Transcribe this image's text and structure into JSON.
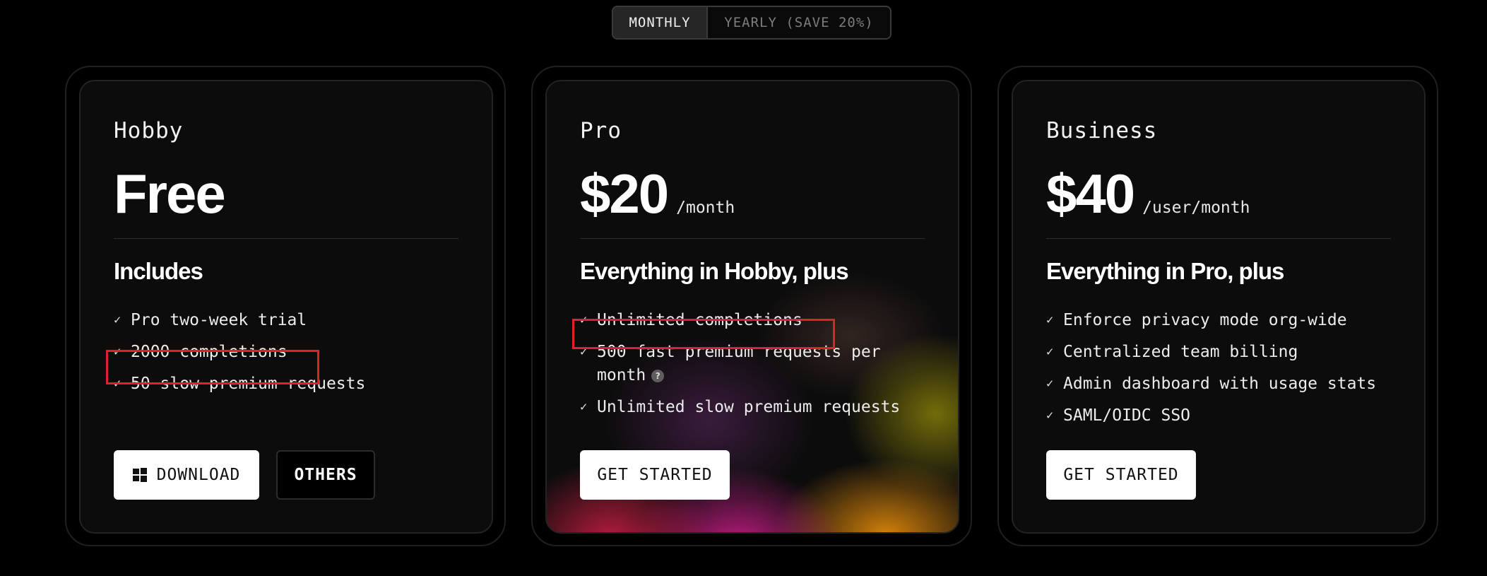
{
  "toggle": {
    "monthly": "MONTHLY",
    "yearly": "YEARLY (SAVE 20%)"
  },
  "plans": [
    {
      "name": "Hobby",
      "price": "Free",
      "period": "",
      "includes": "Includes",
      "features": [
        "Pro two-week trial",
        "2000 completions",
        "50 slow premium requests"
      ],
      "buttons": [
        {
          "label": "DOWNLOAD",
          "icon": "windows-icon"
        },
        {
          "label": "OTHERS"
        }
      ]
    },
    {
      "name": "Pro",
      "price": "$20",
      "period": "/month",
      "includes": "Everything in Hobby, plus",
      "features": [
        "Unlimited completions",
        "500 fast premium requests per month",
        "Unlimited slow premium requests"
      ],
      "buttons": [
        {
          "label": "GET STARTED"
        }
      ]
    },
    {
      "name": "Business",
      "price": "$40",
      "period": "/user/month",
      "includes": "Everything in Pro, plus",
      "features": [
        "Enforce privacy mode org-wide",
        "Centralized team billing",
        "Admin dashboard with usage stats",
        "SAML/OIDC SSO"
      ],
      "buttons": [
        {
          "label": "GET STARTED"
        }
      ]
    }
  ],
  "icons": {
    "check": "✓",
    "info": "?"
  },
  "colors": {
    "highlight": "#e0202a",
    "background": "#000000",
    "card": "#0c0c0c"
  }
}
